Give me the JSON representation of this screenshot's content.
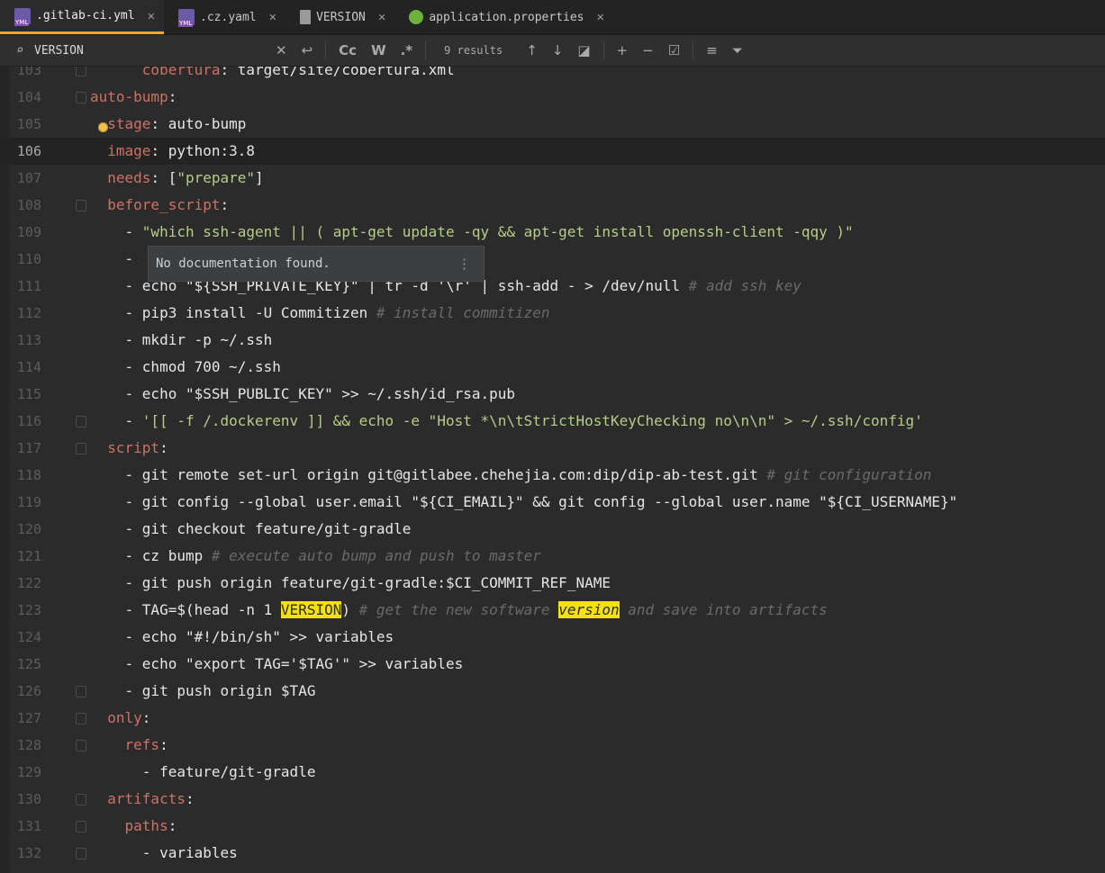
{
  "tabs": [
    {
      "label": ".gitlab-ci.yml",
      "icon": "yml-file-icon",
      "active": true
    },
    {
      "label": ".cz.yaml",
      "icon": "yml-file-icon",
      "active": false
    },
    {
      "label": "VERSION",
      "icon": "text-file-icon",
      "active": false
    },
    {
      "label": "application.properties",
      "icon": "spring-properties-icon",
      "active": false
    }
  ],
  "find": {
    "query": "VERSION",
    "results": "9 results",
    "buttons": [
      "Cc",
      "W",
      ".*"
    ]
  },
  "tooltip": {
    "text": "No documentation found."
  },
  "colors": {
    "keyword": "#cc7266",
    "string": "#b6cd87",
    "comment": "#6a6a6a",
    "highlight": "#f5e10b",
    "active_tab_underline": "#f0a732"
  },
  "code_lines": [
    {
      "n": "103",
      "segs": [
        [
          "      ",
          ""
        ],
        [
          "cobertura",
          "k"
        ],
        [
          ": target/site/cobertura.xml",
          ""
        ]
      ]
    },
    {
      "n": "104",
      "segs": [
        [
          "auto-bump",
          "k"
        ],
        [
          ":",
          ""
        ]
      ]
    },
    {
      "n": "105",
      "segs": [
        [
          "  ",
          ""
        ],
        [
          "stage",
          "k"
        ],
        [
          ": auto-bump",
          ""
        ]
      ]
    },
    {
      "n": "106",
      "segs": [
        [
          "  ",
          ""
        ],
        [
          "image",
          "k"
        ],
        [
          ": python:3.8",
          ""
        ]
      ]
    },
    {
      "n": "107",
      "segs": [
        [
          "  ",
          ""
        ],
        [
          "needs",
          "k"
        ],
        [
          ": [",
          ""
        ],
        [
          "\"prepare\"",
          "s"
        ],
        [
          "]",
          ""
        ]
      ]
    },
    {
      "n": "108",
      "segs": [
        [
          "  ",
          ""
        ],
        [
          "before_script",
          "k"
        ],
        [
          ":",
          ""
        ]
      ]
    },
    {
      "n": "109",
      "segs": [
        [
          "    - ",
          ""
        ],
        [
          "\"which ssh-agent || ( apt-get update -qy && apt-get install openssh-client -qqy )\"",
          "s"
        ]
      ]
    },
    {
      "n": "110",
      "segs": [
        [
          "    - ",
          ""
        ]
      ]
    },
    {
      "n": "111",
      "segs": [
        [
          "    - echo \"${SSH_PRIVATE_KEY}\" | tr -d '\\r' | ssh-add - > /dev/null ",
          ""
        ],
        [
          "# add ssh key",
          "c"
        ]
      ]
    },
    {
      "n": "112",
      "segs": [
        [
          "    - pip3 install -U Commitizen ",
          ""
        ],
        [
          "# install commitizen",
          "c"
        ]
      ]
    },
    {
      "n": "113",
      "segs": [
        [
          "    - mkdir -p ~/.ssh",
          ""
        ]
      ]
    },
    {
      "n": "114",
      "segs": [
        [
          "    - chmod 700 ~/.ssh",
          ""
        ]
      ]
    },
    {
      "n": "115",
      "segs": [
        [
          "    - echo \"$SSH_PUBLIC_KEY\" >> ~/.ssh/id_rsa.pub",
          ""
        ]
      ]
    },
    {
      "n": "116",
      "segs": [
        [
          "    - ",
          ""
        ],
        [
          "'[[ -f /.dockerenv ]] && echo -e \"Host *\\n\\tStrictHostKeyChecking no\\n\\n\" > ~/.ssh/config'",
          "s"
        ]
      ]
    },
    {
      "n": "117",
      "segs": [
        [
          "  ",
          ""
        ],
        [
          "script",
          "k"
        ],
        [
          ":",
          ""
        ]
      ]
    },
    {
      "n": "118",
      "segs": [
        [
          "    - git remote set-url origin git@gitlabee.chehejia.com:dip/dip-ab-test.git ",
          ""
        ],
        [
          "# git configuration",
          "c"
        ]
      ]
    },
    {
      "n": "119",
      "segs": [
        [
          "    - git config --global user.email \"${CI_EMAIL}\" && git config --global user.name \"${CI_USERNAME}\"",
          ""
        ]
      ]
    },
    {
      "n": "120",
      "segs": [
        [
          "    - git checkout feature/git-gradle",
          ""
        ]
      ]
    },
    {
      "n": "121",
      "segs": [
        [
          "    - cz bump ",
          ""
        ],
        [
          "# execute auto bump and push to master",
          "c"
        ]
      ]
    },
    {
      "n": "122",
      "segs": [
        [
          "    - git push origin feature/git-gradle:$CI_COMMIT_REF_NAME",
          ""
        ]
      ]
    },
    {
      "n": "123",
      "segs": [
        [
          "    - TAG=$(head -n 1 ",
          ""
        ],
        [
          "VERSION",
          "hl"
        ],
        [
          ") ",
          ""
        ],
        [
          "# get the new software ",
          "c"
        ],
        [
          "version",
          "hl c"
        ],
        [
          " and save into artifacts",
          "c"
        ]
      ]
    },
    {
      "n": "124",
      "segs": [
        [
          "    - echo \"#!/bin/sh\" >> variables",
          ""
        ]
      ]
    },
    {
      "n": "125",
      "segs": [
        [
          "    - echo \"export TAG='$TAG'\" >> variables",
          ""
        ]
      ]
    },
    {
      "n": "126",
      "segs": [
        [
          "    - git push origin $TAG",
          ""
        ]
      ]
    },
    {
      "n": "127",
      "segs": [
        [
          "  ",
          ""
        ],
        [
          "only",
          "k"
        ],
        [
          ":",
          ""
        ]
      ]
    },
    {
      "n": "128",
      "segs": [
        [
          "    ",
          ""
        ],
        [
          "refs",
          "k"
        ],
        [
          ":",
          ""
        ]
      ]
    },
    {
      "n": "129",
      "segs": [
        [
          "      - feature/git-gradle",
          ""
        ]
      ]
    },
    {
      "n": "130",
      "segs": [
        [
          "  ",
          ""
        ],
        [
          "artifacts",
          "k"
        ],
        [
          ":",
          ""
        ]
      ]
    },
    {
      "n": "131",
      "segs": [
        [
          "    ",
          ""
        ],
        [
          "paths",
          "k"
        ],
        [
          ":",
          ""
        ]
      ]
    },
    {
      "n": "132",
      "segs": [
        [
          "      - variables",
          ""
        ]
      ]
    }
  ]
}
